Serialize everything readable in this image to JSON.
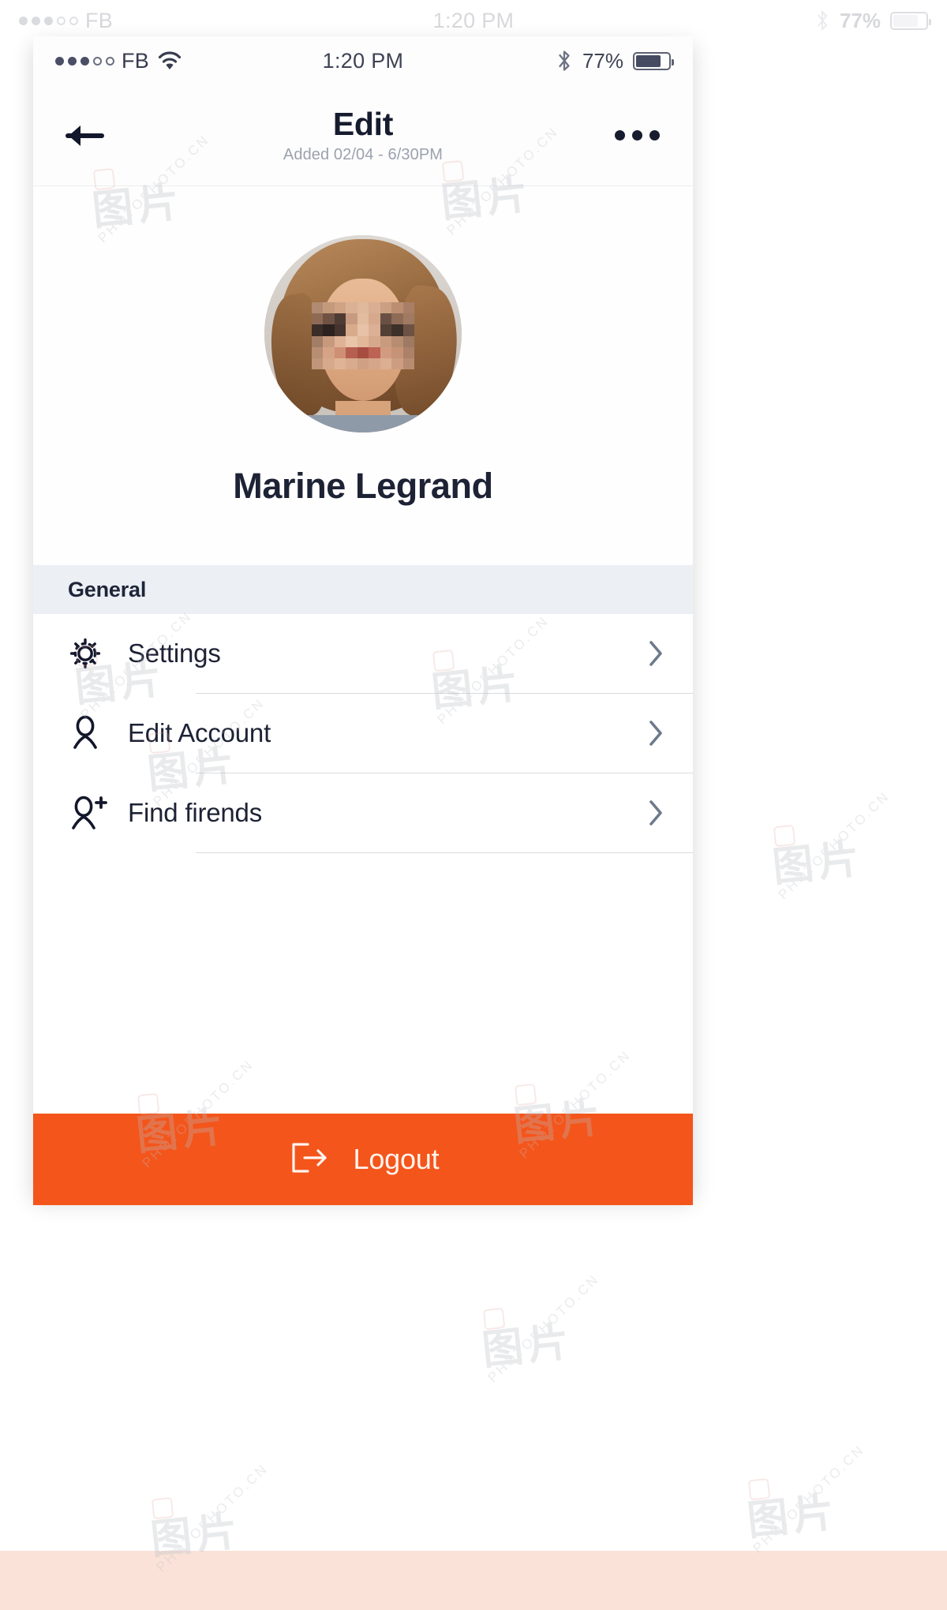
{
  "colors": {
    "accent_orange": "#f4551b",
    "text_dark": "#1d2235",
    "text_muted": "#9ba1ad",
    "section_band": "#eceff4",
    "separator": "#d8dbe0"
  },
  "status_bar": {
    "signal_dots_filled": 3,
    "signal_dots_total": 5,
    "carrier": "FB",
    "wifi_icon": "wifi-icon",
    "time": "1:20 PM",
    "bluetooth_icon": "bluetooth-icon",
    "battery_percent": "77%",
    "battery_level": 77
  },
  "navbar": {
    "back_icon": "arrow-left-icon",
    "title": "Edit",
    "subtitle": "Added 02/04 - 6/30PM",
    "more_icon": "more-horizontal-icon"
  },
  "profile": {
    "avatar_alt": "user-avatar",
    "name": "Marine Legrand"
  },
  "sections": [
    {
      "header": "General",
      "items": [
        {
          "icon": "gear-icon",
          "label": "Settings",
          "chevron": "chevron-right-icon"
        },
        {
          "icon": "user-icon",
          "label": "Edit Account",
          "chevron": "chevron-right-icon"
        },
        {
          "icon": "user-plus-icon",
          "label": "Find firends",
          "chevron": "chevron-right-icon"
        }
      ]
    }
  ],
  "logout": {
    "icon": "logout-icon",
    "label": "Logout"
  },
  "watermark": {
    "cjk": "图片",
    "latin": "PHOTOPHOTO.CN"
  }
}
